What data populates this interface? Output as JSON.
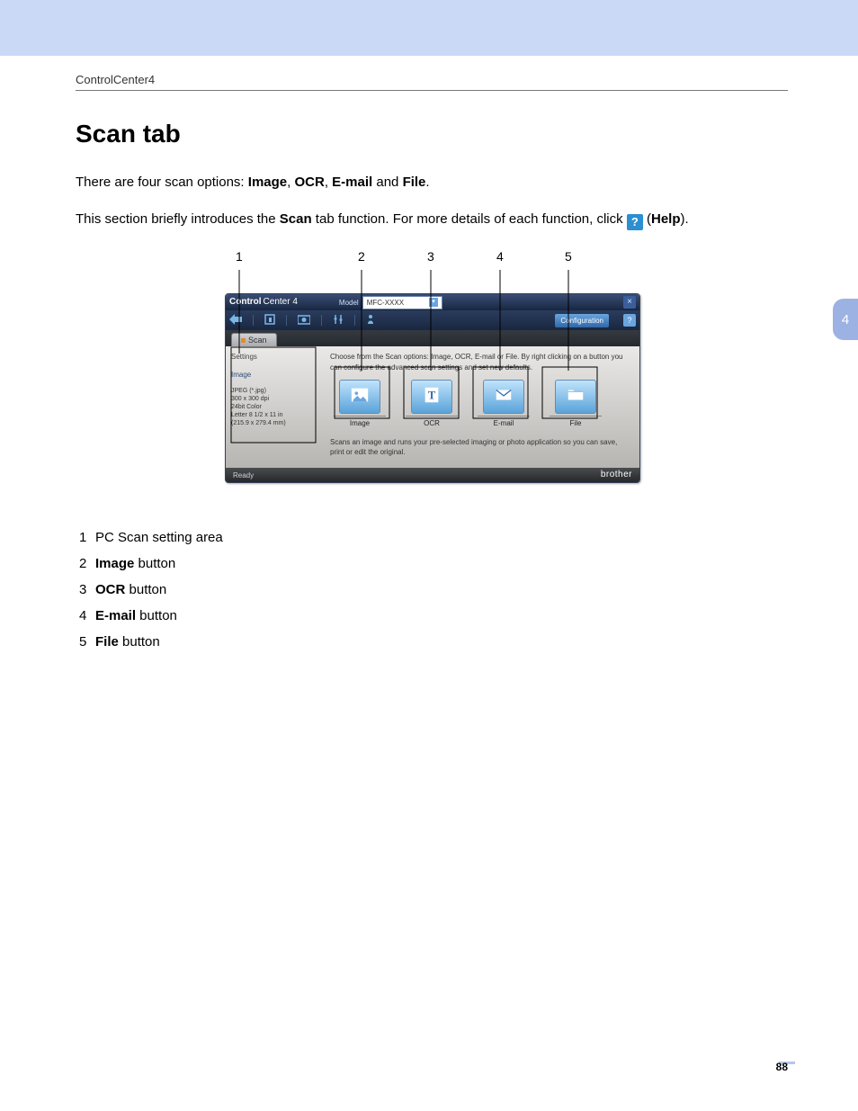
{
  "header": {
    "breadcrumb": "ControlCenter4"
  },
  "title": "Scan tab",
  "para1": {
    "pre": "There are four scan options: ",
    "opt1": "Image",
    "c1": ", ",
    "opt2": "OCR",
    "c2": ", ",
    "opt3": "E-mail",
    "c3": " and ",
    "opt4": "File",
    "post": "."
  },
  "para2": {
    "pre": "This section briefly introduces the ",
    "scan": "Scan",
    "mid": " tab function. For more details of each function, click ",
    "help_glyph": "?",
    "open": " (",
    "help": "Help",
    "close": ")."
  },
  "callouts": [
    "1",
    "2",
    "3",
    "4",
    "5"
  ],
  "app": {
    "brand1": "Control",
    "brand2": "Center 4",
    "model_label": "Model",
    "model_value": "MFC-XXXX",
    "close_glyph": "×",
    "cfg": "Configuration",
    "help_glyph": "?",
    "tab": "Scan",
    "side": {
      "settings": "Settings",
      "image": "Image",
      "l1": "JPEG (*.jpg)",
      "l2": "300 x 300 dpi",
      "l3": "24bit Color",
      "l4": "Letter 8 1/2 x 11 in",
      "l5": "(215.9 x 279.4 mm)"
    },
    "hint": "Choose from the Scan options: Image, OCR, E-mail or File. By right clicking on a button you can configure the advanced scan settings and set new defaults.",
    "buttons": {
      "image": "Image",
      "ocr": "OCR",
      "email": "E-mail",
      "file": "File"
    },
    "desc": "Scans an image and runs your pre-selected imaging or photo application so you can save, print or edit the original.",
    "status": "Ready",
    "logo": "brother"
  },
  "legend": {
    "i1": "PC Scan setting area",
    "i2b": "Image",
    "i2": " button",
    "i3b": "OCR",
    "i3": " button",
    "i4b": "E-mail",
    "i4": " button",
    "i5b": "File",
    "i5": " button"
  },
  "page_tab": "4",
  "page_number": "88"
}
